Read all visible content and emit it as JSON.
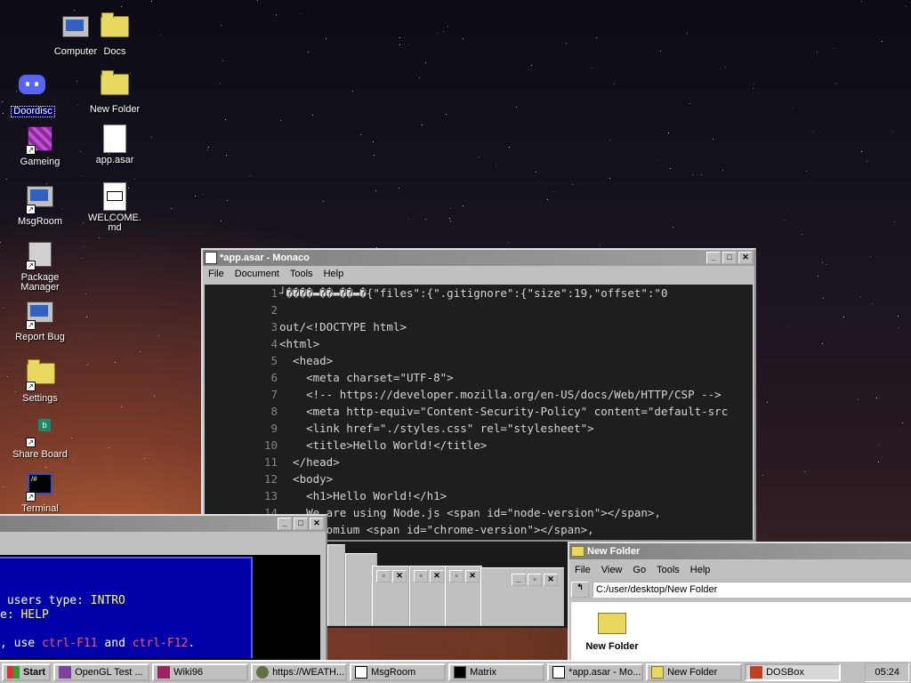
{
  "desktop": {
    "icons": [
      {
        "label": "Computer"
      },
      {
        "label": "Docs"
      },
      {
        "label": "Doordisc"
      },
      {
        "label": "New Folder"
      },
      {
        "label": "Gameing"
      },
      {
        "label": "app.asar"
      },
      {
        "label": "MsgRoom"
      },
      {
        "label": "WELCOME.md"
      },
      {
        "label": "Package Manager"
      },
      {
        "label": "Report Bug"
      },
      {
        "label": "Settings"
      },
      {
        "label": "Share Board"
      },
      {
        "label": "Terminal"
      }
    ]
  },
  "editor_window": {
    "title": "*app.asar - Monaco",
    "menu": [
      "File",
      "Document",
      "Tools",
      "Help"
    ],
    "lines": [
      {
        "n": "1",
        "text": "┘����▬��▬��▬�{\"files\":{\".gitignore\":{\"size\":19,\"offset\":\"0"
      },
      {
        "n": "2",
        "text": ""
      },
      {
        "n": "3",
        "text": "out/<!DOCTYPE html>"
      },
      {
        "n": "4",
        "text": "<html>"
      },
      {
        "n": "5",
        "text": "  <head>"
      },
      {
        "n": "6",
        "text": "    <meta charset=\"UTF-8\">"
      },
      {
        "n": "7",
        "text": "    <!-- https://developer.mozilla.org/en-US/docs/Web/HTTP/CSP -->"
      },
      {
        "n": "8",
        "text": "    <meta http-equiv=\"Content-Security-Policy\" content=\"default-src"
      },
      {
        "n": "9",
        "text": "    <link href=\"./styles.css\" rel=\"stylesheet\">"
      },
      {
        "n": "10",
        "text": "    <title>Hello World!</title>"
      },
      {
        "n": "11",
        "text": "  </head>"
      },
      {
        "n": "12",
        "text": "  <body>"
      },
      {
        "n": "13",
        "text": "    <h1>Hello World!</h1>"
      },
      {
        "n": "14",
        "text": "    We are using Node.js <span id=\"node-version\"></span>,"
      },
      {
        "n": "15",
        "text": "    Chromium <span id=\"chrome-version\"></span>,"
      }
    ]
  },
  "dos_window": {
    "lines": [
      {
        "a": " users type: ",
        "b": "INTRO",
        "c": ""
      },
      {
        "a": "e: ",
        "b": "HELP",
        "c": ""
      },
      {
        "a": "",
        "b": "",
        "c": ""
      },
      {
        "a": ", use ",
        "b": "ctrl-F11",
        "c": " and ",
        "d": "ctrl-F12",
        "e": "."
      }
    ]
  },
  "folder_window": {
    "title": "New Folder",
    "menu": [
      "File",
      "View",
      "Go",
      "Tools",
      "Help"
    ],
    "address": "C:/user/desktop/New Folder",
    "item_label": "New Folder"
  },
  "taskbar": {
    "start": "Start",
    "buttons": [
      "OpenGL Test ...",
      "Wiki96",
      "https://WEATH...",
      "MsgRoom",
      "Matrix",
      "*app.asar - Mo...",
      "New Folder",
      "DOSBox"
    ],
    "clock": "05:24"
  },
  "colors": {
    "desktop_dark": "#0c0c16",
    "dos_blue": "#0000a8",
    "titlebar_inactive": "#808080"
  }
}
